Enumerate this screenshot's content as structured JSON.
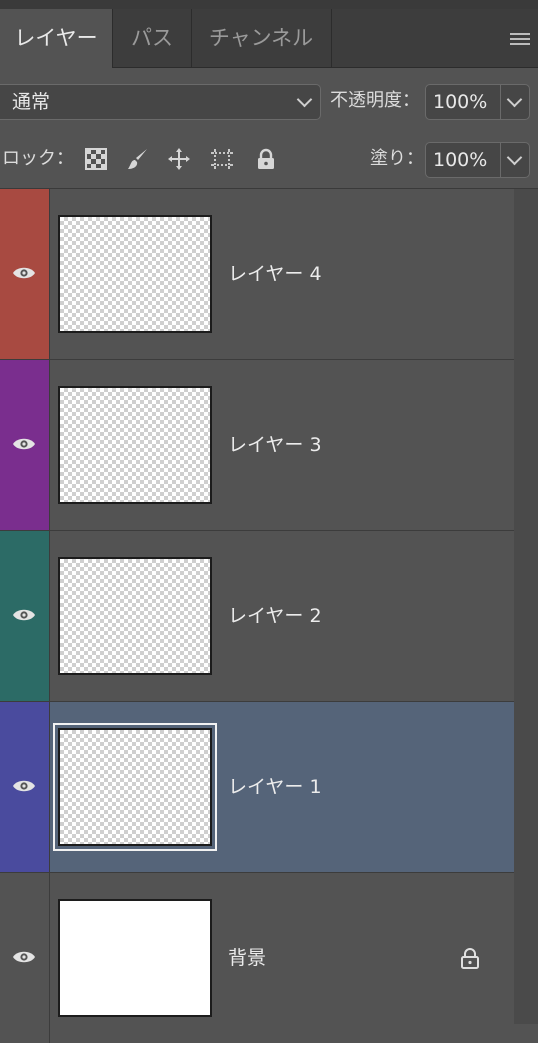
{
  "tabs": [
    {
      "label": "レイヤー",
      "active": true
    },
    {
      "label": "パス",
      "active": false
    },
    {
      "label": "チャンネル",
      "active": false
    }
  ],
  "options": {
    "blend_mode": "通常",
    "opacity_label": "不透明度：",
    "opacity_value": "100%",
    "lock_label": "ロック：",
    "fill_label": "塗り：",
    "fill_value": "100%"
  },
  "layers": [
    {
      "name": "レイヤー 4",
      "color": "#a84a41",
      "visible": true,
      "selected": false,
      "thumbnail": "transparent"
    },
    {
      "name": "レイヤー 3",
      "color": "#7a2e8e",
      "visible": true,
      "selected": false,
      "thumbnail": "transparent"
    },
    {
      "name": "レイヤー 2",
      "color": "#2c6b66",
      "visible": true,
      "selected": false,
      "thumbnail": "transparent"
    },
    {
      "name": "レイヤー 1",
      "color": "#4a4b9e",
      "visible": true,
      "selected": true,
      "thumbnail": "transparent"
    },
    {
      "name": "背景",
      "color": "#535353",
      "visible": true,
      "selected": false,
      "thumbnail": "white",
      "locked": true
    }
  ],
  "icons": [
    "panel-menu-icon",
    "chevron-down-icon",
    "lock-transparent-pixels-icon",
    "lock-image-pixels-icon",
    "lock-position-icon",
    "lock-artboard-icon",
    "lock-all-icon",
    "eye-icon",
    "lock-icon"
  ],
  "colors": {
    "panel_bg": "#535353",
    "selected_row": "#556479"
  }
}
